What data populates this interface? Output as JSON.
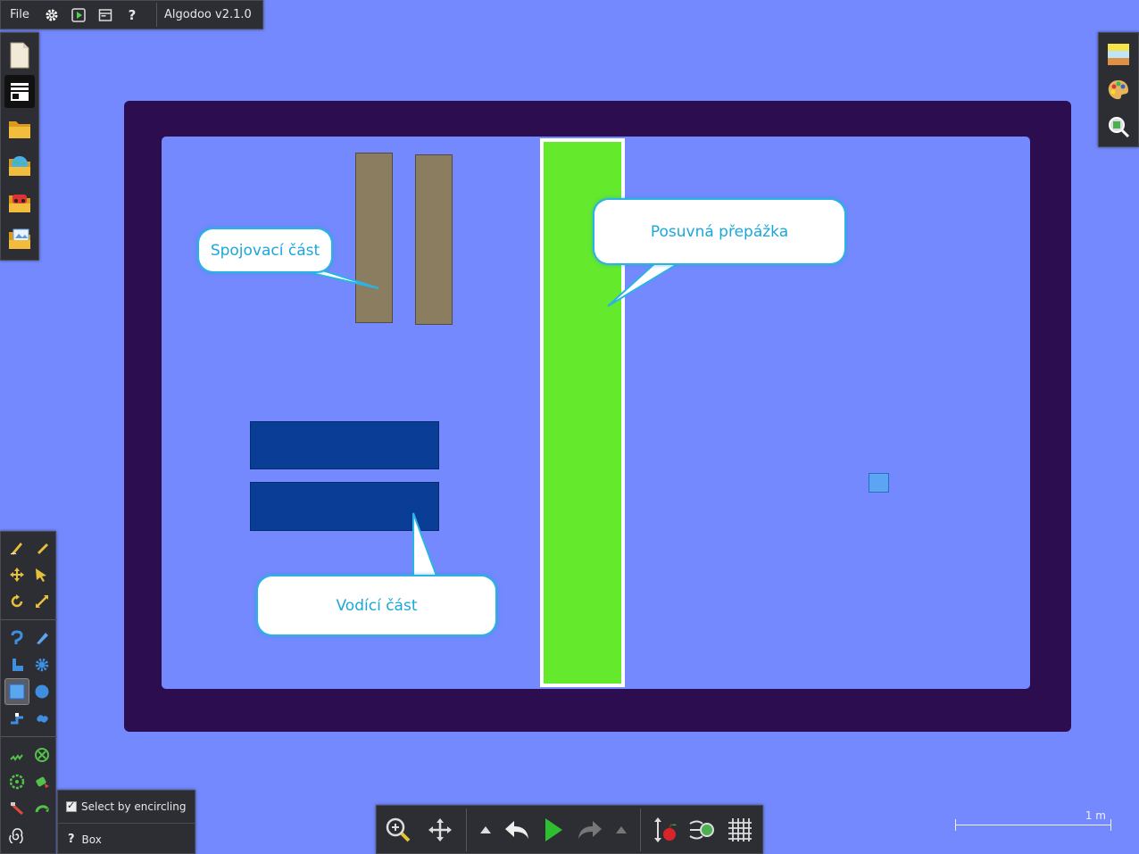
{
  "app": {
    "menu_file": "File",
    "version": "Algodoo v2.1.0"
  },
  "scene": {
    "labels": {
      "spojovaci": "Spojovací část",
      "posuvna": "Posuvná přepážka",
      "vodici": "Vodící část"
    },
    "colors": {
      "frame": "#2b0d50",
      "background": "#7389fd",
      "divider": "#64e92d",
      "connector": "#8b7d5f",
      "guide": "#0a3e96",
      "small_box": "#5ba5f3"
    }
  },
  "options": {
    "select_by_encircling": "Select by encircling",
    "select_checked": true,
    "box_label": "Box",
    "help_glyph": "?"
  },
  "scale": {
    "label": "1 m"
  },
  "icons": {
    "top": [
      "gear-icon",
      "play-scene-icon",
      "window-icon",
      "help-icon"
    ],
    "left": [
      "new-scene-icon",
      "scene-panel-icon",
      "open-folder-icon",
      "algobox-folder-icon",
      "car-folder-icon",
      "picture-folder-icon"
    ],
    "right": [
      "background-icon",
      "palette-icon",
      "zoom-fit-icon"
    ],
    "bottom": [
      "zoom-icon",
      "move-icon",
      "undo-history-icon",
      "undo-icon",
      "play-icon",
      "redo-icon",
      "redo-history-icon",
      "gravity-icon",
      "air-friction-icon",
      "grid-icon"
    ]
  },
  "top_help": "?"
}
